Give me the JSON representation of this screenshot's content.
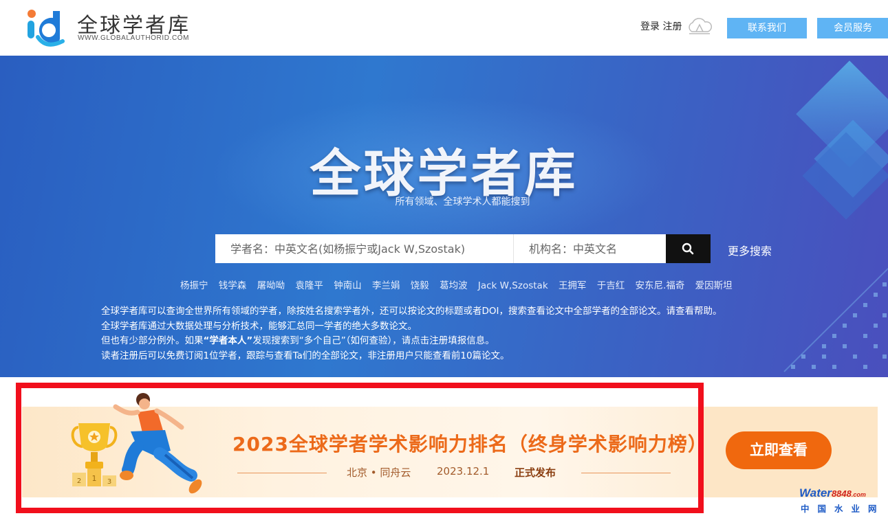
{
  "header": {
    "logo_title": "全球学者库",
    "logo_sub": "WWW.GLOBALAUTHORID.COM",
    "login_register": "登录 注册",
    "contact_button": "联系我们",
    "member_button": "会员服务"
  },
  "hero": {
    "title": "全球学者库",
    "subtitle": "所有领域、全球学术人都能搜到",
    "search": {
      "name_placeholder": "学者名：中英文名(如杨振宁或Jack W,Szostak)",
      "org_placeholder": "机构名：中英文名",
      "more": "更多搜索"
    },
    "names": [
      "杨振宁",
      "钱学森",
      "屠呦呦",
      "袁隆平",
      "钟南山",
      "李兰娟",
      "饶毅",
      "葛均波",
      "Jack W,Szostak",
      "王拥军",
      "于吉红",
      "安东尼.福奇",
      "爱因斯坦"
    ],
    "description": {
      "line1_text": "全球学者库可以查询全世界所有领域的学者，除按姓名搜索学者外，还可以按论文的标题或者DOI，搜索查看论文中全部学者的全部论文。请查看",
      "line1_link": "帮助",
      "line1_end": "。",
      "line2": "全球学者库通过大数据处理与分析技术，能够汇总同一学者的绝大多数论文。",
      "line3_a": "但也有少部分例外。如果",
      "line3_strong": "“学者本人”",
      "line3_b": "发现搜索到“多个自己”（",
      "line3_link1": "如何查验",
      "line3_c": "），请点击",
      "line3_link2": "注册",
      "line3_d": "填报信息。",
      "line4": "读者注册后可以免费订阅1位学者，跟踪与查看Ta们的全部论文，非注册用户只能查看前10篇论文。"
    }
  },
  "banner": {
    "title": "2023全球学者学术影响力排名（终身学术影响力榜）",
    "sub_place": "北京 • 同舟云",
    "sub_date": "2023.12.1",
    "sub_release": "正式发布",
    "cta": "立即查看",
    "trophy_ranks": [
      "2",
      "1",
      "3"
    ]
  },
  "watermark": {
    "brand_a": "Water",
    "brand_b": "8848",
    "brand_c": ".com",
    "cn": "中国水业网"
  },
  "colors": {
    "hero_blue": "#2f78cf",
    "header_button": "#5fb4f4",
    "banner_orange": "#ec6a1a",
    "cta_orange": "#f0680e",
    "highlight_red": "#f10f1c"
  }
}
